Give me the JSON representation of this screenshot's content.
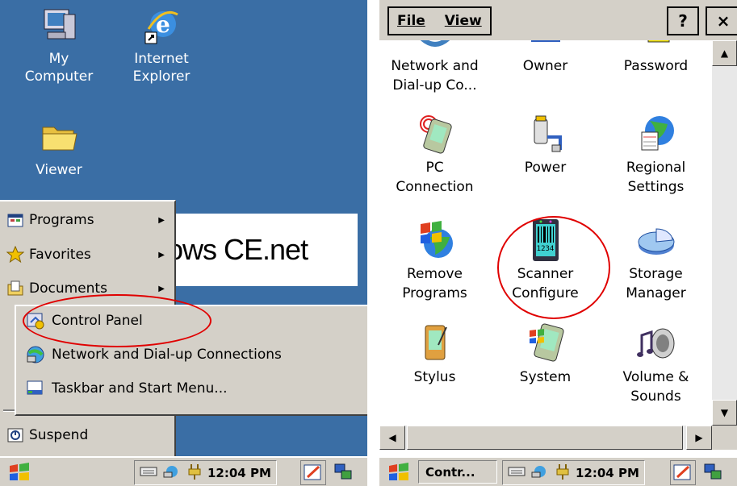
{
  "left_screen": {
    "desktop_icons": [
      {
        "label_line1": "My",
        "label_line2": "Computer",
        "icon": "my-computer-icon"
      },
      {
        "label_line1": "Internet",
        "label_line2": "Explorer",
        "icon": "internet-explorer-icon"
      },
      {
        "label_line1": "Viewer",
        "label_line2": "",
        "icon": "folder-icon"
      }
    ],
    "banner_text": "ows CE.net",
    "start_menu": {
      "items": [
        {
          "label": "Programs",
          "icon": "programs-icon",
          "has_submenu": true
        },
        {
          "label": "Favorites",
          "icon": "star-icon",
          "has_submenu": true
        },
        {
          "label": "Documents",
          "icon": "documents-icon",
          "has_submenu": true
        },
        {
          "label": "Suspend",
          "icon": "suspend-icon",
          "has_submenu": false
        }
      ]
    },
    "settings_submenu": {
      "items": [
        {
          "label": "Control Panel",
          "icon": "control-panel-icon"
        },
        {
          "label": "Network and Dial-up Connections",
          "icon": "network-icon"
        },
        {
          "label": "Taskbar and Start Menu...",
          "icon": "taskbar-icon"
        }
      ]
    },
    "taskbar": {
      "time": "12:04 PM"
    }
  },
  "right_screen": {
    "menu": {
      "file": "File",
      "view": "View"
    },
    "buttons": {
      "help": "?",
      "close": "×"
    },
    "items": [
      {
        "line1": "Network and",
        "line2": "Dial-up Co...",
        "icon": "network-dialup-icon"
      },
      {
        "line1": "Owner",
        "line2": "",
        "icon": "owner-icon"
      },
      {
        "line1": "Password",
        "line2": "",
        "icon": "password-icon"
      },
      {
        "line1": "PC",
        "line2": "Connection",
        "icon": "pc-connection-icon"
      },
      {
        "line1": "Power",
        "line2": "",
        "icon": "power-icon"
      },
      {
        "line1": "Regional",
        "line2": "Settings",
        "icon": "regional-settings-icon"
      },
      {
        "line1": "Remove",
        "line2": "Programs",
        "icon": "remove-programs-icon"
      },
      {
        "line1": "Scanner",
        "line2": "Configure",
        "icon": "scanner-icon",
        "icon_text": "1234"
      },
      {
        "line1": "Storage",
        "line2": "Manager",
        "icon": "storage-manager-icon"
      },
      {
        "line1": "Stylus",
        "line2": "",
        "icon": "stylus-icon"
      },
      {
        "line1": "System",
        "line2": "",
        "icon": "system-icon"
      },
      {
        "line1": "Volume &",
        "line2": "Sounds",
        "icon": "volume-sounds-icon"
      }
    ],
    "taskbar": {
      "task_label": "Contr...",
      "time": "12:04 PM"
    }
  },
  "colors": {
    "desktop": "#3a6ea5",
    "chrome": "#d4d0c8",
    "annotation": "#e00000"
  }
}
